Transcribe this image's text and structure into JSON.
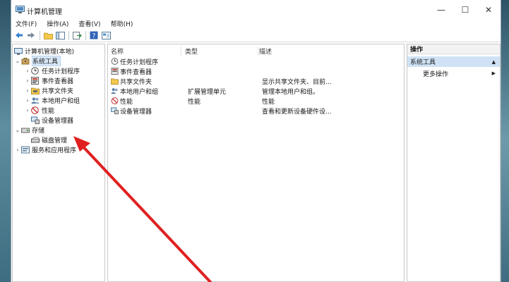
{
  "window": {
    "title": "计算机管理",
    "minimize_symbol": "—",
    "maximize_symbol": "☐",
    "close_symbol": "✕"
  },
  "menu": {
    "items": [
      "文件(F)",
      "操作(A)",
      "查看(V)",
      "帮助(H)"
    ]
  },
  "toolbar": {
    "icons": [
      "back-arrow-icon",
      "forward-arrow-icon",
      "folder-up-icon",
      "console-tree-icon",
      "export-icon",
      "help-icon",
      "properties-icon"
    ]
  },
  "tree": {
    "root": "计算机管理(本地)",
    "system_tools": "系统工具",
    "system_tools_children": [
      "任务计划程序",
      "事件查看器",
      "共享文件夹",
      "本地用户和组",
      "性能",
      "设备管理器"
    ],
    "storage": "存储",
    "disk_management": "磁盘管理",
    "services": "服务和应用程序"
  },
  "list": {
    "headers": {
      "name": "名称",
      "type": "类型",
      "desc": "描述"
    },
    "rows": [
      {
        "name": "任务计划程序",
        "type": "",
        "desc": ""
      },
      {
        "name": "事件查看器",
        "type": "",
        "desc": ""
      },
      {
        "name": "共享文件夹",
        "type": "",
        "desc": "显示共享文件夹、目前..."
      },
      {
        "name": "本地用户和组",
        "type": "扩展管理单元",
        "desc": "管理本地用户和组。"
      },
      {
        "name": "性能",
        "type": "性能",
        "desc": "性能"
      },
      {
        "name": "设备管理器",
        "type": "",
        "desc": "查看和更新设备硬件设..."
      }
    ]
  },
  "actions": {
    "title": "操作",
    "section": "系统工具",
    "section_arrow": "▲",
    "more": "更多操作",
    "more_arrow": "▶"
  },
  "colors": {
    "annotation_arrow": "#e02020",
    "selection": "#d9e8f7"
  }
}
